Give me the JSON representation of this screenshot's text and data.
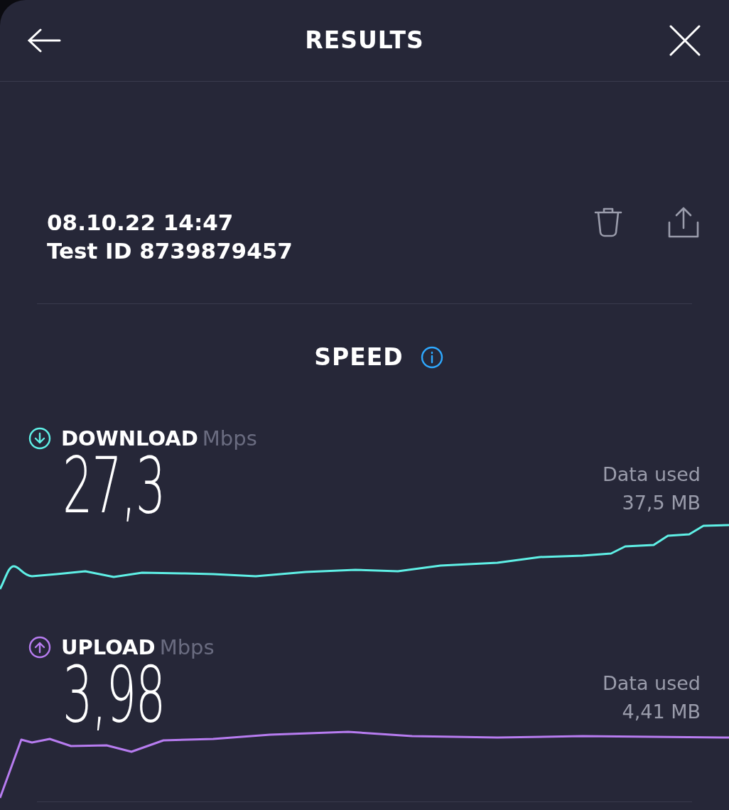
{
  "header": {
    "title": "RESULTS"
  },
  "test": {
    "datetime": "08.10.22 14:47",
    "test_id": "Test ID 8739879457"
  },
  "section": {
    "title": "SPEED"
  },
  "metrics": [
    {
      "kind": "download",
      "label": "DOWNLOAD",
      "unit": "Mbps",
      "value": "27,3",
      "data_used_label": "Data used",
      "data_used": "37,5 MB"
    },
    {
      "kind": "upload",
      "label": "UPLOAD",
      "unit": "Mbps",
      "value": "3,98",
      "data_used_label": "Data used",
      "data_used": "4,41 MB"
    }
  ]
}
